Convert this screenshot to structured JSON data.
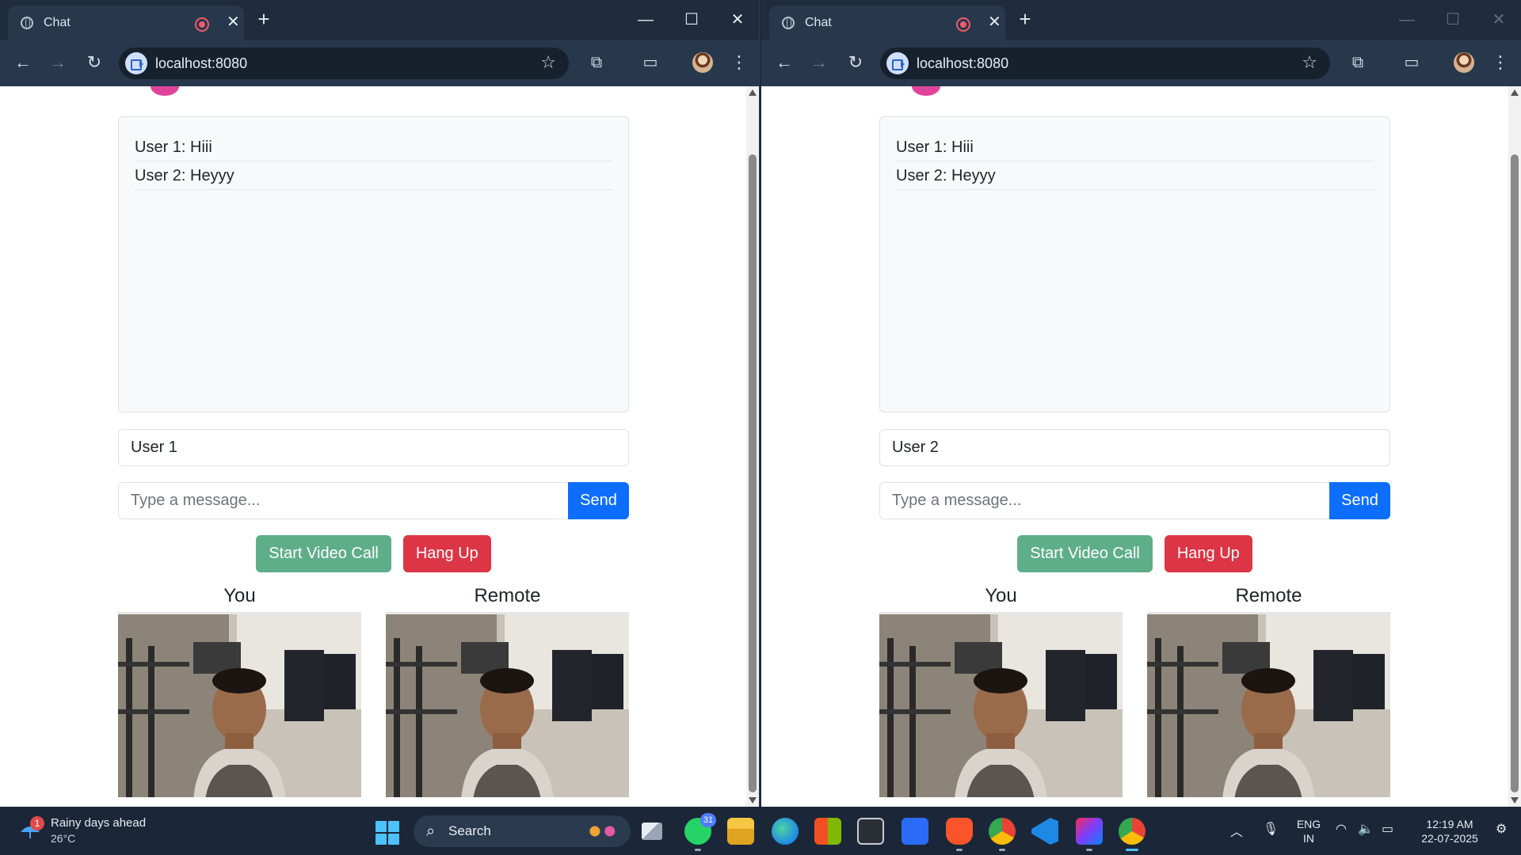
{
  "windows": [
    {
      "tab_title": "Chat",
      "url": "localhost:8080",
      "chat": {
        "messages": [
          "User 1: Hiii",
          "User 2: Heyyy"
        ],
        "username_value": "User 1",
        "message_placeholder": "Type a message...",
        "send_label": "Send",
        "start_call_label": "Start Video Call",
        "hang_up_label": "Hang Up",
        "local_video_label": "You",
        "remote_video_label": "Remote"
      }
    },
    {
      "tab_title": "Chat",
      "url": "localhost:8080",
      "chat": {
        "messages": [
          "User 1: Hiii",
          "User 2: Heyyy"
        ],
        "username_value": "User 2",
        "message_placeholder": "Type a message...",
        "send_label": "Send",
        "start_call_label": "Start Video Call",
        "hang_up_label": "Hang Up",
        "local_video_label": "You",
        "remote_video_label": "Remote"
      }
    }
  ],
  "taskbar": {
    "weather": {
      "line1": "Rainy days ahead",
      "line2": "26°C",
      "badge": "1"
    },
    "search_label": "Search",
    "whatsapp_badge": "31",
    "apps": [
      "task-view",
      "whatsapp",
      "file-explorer",
      "edge",
      "microsoft-store",
      "unity",
      "jetbrains-toolbox",
      "brave",
      "chrome",
      "vscode",
      "intellij",
      "chrome-active"
    ],
    "language": {
      "line1": "ENG",
      "line2": "IN"
    },
    "clock": {
      "time": "12:19 AM",
      "date": "22-07-2025"
    }
  },
  "colors": {
    "send_button": "#0d6efd",
    "start_call_button": "#5fae8a",
    "hang_up_button": "#dc3545",
    "browser_frame": "#1f2c3d",
    "taskbar": "#1b2738"
  }
}
